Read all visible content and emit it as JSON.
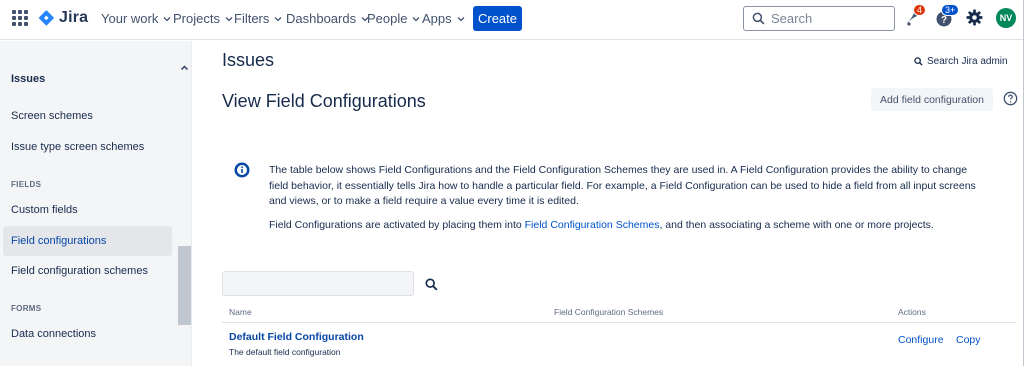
{
  "topnav": {
    "logo_text": "Jira",
    "items": [
      {
        "label": "Your work"
      },
      {
        "label": "Projects"
      },
      {
        "label": "Filters"
      },
      {
        "label": "Dashboards"
      },
      {
        "label": "People"
      },
      {
        "label": "Apps"
      }
    ],
    "create_label": "Create",
    "search_placeholder": "Search",
    "notifications_badge": "4",
    "help_badge": "3+",
    "avatar_initials": "NV",
    "colors": {
      "brand": "#0052cc",
      "badge_red": "#de350b",
      "badge_blue": "#0052cc",
      "avatar": "#00875a"
    }
  },
  "sidebar": {
    "title": "Issues",
    "items": [
      {
        "label": "Screen schemes"
      },
      {
        "label": "Issue type screen schemes"
      },
      {
        "label": "Custom fields"
      },
      {
        "label": "Field configurations"
      },
      {
        "label": "Field configuration schemes"
      },
      {
        "label": "Data connections"
      }
    ],
    "sections": [
      "FIELDS",
      "FORMS"
    ]
  },
  "main": {
    "page_title": "Issues",
    "search_admin_label": "Search Jira admin",
    "view_title": "View Field Configurations",
    "add_button_label": "Add field configuration",
    "info_paragraph": "The table below shows Field Configurations and the Field Configuration Schemes they are used in. A Field Configuration provides the ability to change field behavior, it essentially tells Jira how to handle a particular field. For example, a Field Configuration can be used to hide a field from all input screens and views, or to make a field require a value every time it is edited.",
    "info2_prefix": "Field Configurations are activated by placing them into ",
    "info2_link": "Field Configuration Schemes",
    "info2_suffix": ", and then associating a scheme with one or more projects.",
    "table": {
      "headers": [
        "Name",
        "Field Configuration Schemes",
        "Actions"
      ],
      "rows": [
        {
          "name": "Default Field Configuration",
          "description": "The default field configuration",
          "actions": [
            "Configure",
            "Copy"
          ]
        }
      ]
    }
  }
}
